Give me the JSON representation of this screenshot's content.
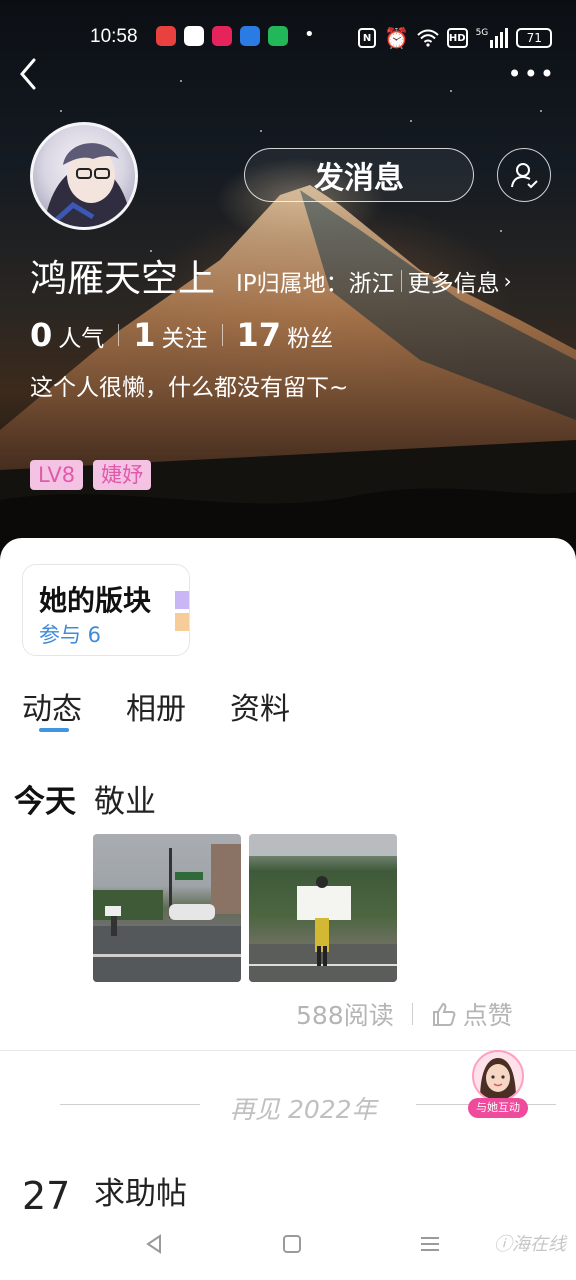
{
  "status_bar": {
    "time": "10:58",
    "battery": "71",
    "network": "5G",
    "hd": "HD",
    "app_icons": [
      "app-icon-red",
      "wechat-icon",
      "video-icon",
      "browser-icon",
      "chat-icon"
    ],
    "colors": [
      "#e8413f",
      "#ffffff",
      "#e6245c",
      "#2b7be5",
      "#22b85a"
    ]
  },
  "header": {
    "more_label": "•••"
  },
  "profile": {
    "username": "鸿雁天空上",
    "ip_label": "IP归属地：浙江",
    "more_info_label": "更多信息",
    "message_button": "发消息",
    "stats": [
      {
        "value": "0",
        "label": "人气"
      },
      {
        "value": "1",
        "label": "关注"
      },
      {
        "value": "17",
        "label": "粉丝"
      }
    ],
    "bio": "这个人很懒，什么都没有留下~",
    "tags": [
      "LV8",
      "婕妤"
    ]
  },
  "block_card": {
    "title": "她的版块",
    "subtitle": "参与 6"
  },
  "tabs": [
    "动态",
    "相册",
    "资料"
  ],
  "post": {
    "date": "今天",
    "title": "敬业",
    "reads": "588阅读",
    "like_label": "点赞"
  },
  "year_separator": "再见 2022年",
  "interact_label": "与她互动",
  "next_post": {
    "day": "27",
    "title": "求助帖"
  },
  "watermark": "ⓘ海在线",
  "accent_color": "#3f95e0",
  "tag_color": "#f4c3e3"
}
